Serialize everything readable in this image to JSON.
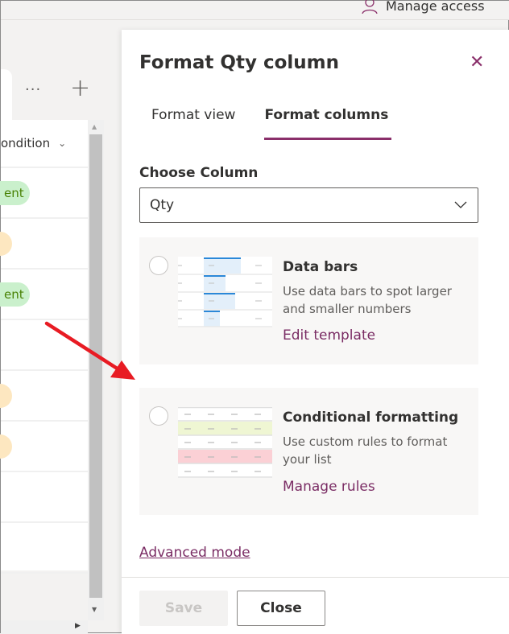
{
  "header": {
    "manage_access": "Manage access"
  },
  "list": {
    "more": "···",
    "add": "+",
    "column_header": "ondition",
    "rows": [
      {
        "pill": "ent",
        "color": "green"
      },
      {
        "pill": "",
        "color": "orange"
      },
      {
        "pill": "ent",
        "color": "green"
      },
      {
        "pill": "",
        "color": "none"
      },
      {
        "pill": "",
        "color": "orange"
      },
      {
        "pill": "",
        "color": "orange"
      },
      {
        "pill": "",
        "color": "none"
      },
      {
        "pill": "",
        "color": "none"
      }
    ]
  },
  "panel": {
    "title": "Format Qty column",
    "close": "✕",
    "tabs": [
      "Format view",
      "Format columns"
    ],
    "active_tab": "Format columns",
    "choose_label": "Choose Column",
    "selected_column": "Qty",
    "cards": [
      {
        "title": "Data bars",
        "desc": "Use data bars to spot larger and smaller numbers",
        "link": "Edit template"
      },
      {
        "title": "Conditional formatting",
        "desc": "Use custom rules to format your list",
        "link": "Manage rules"
      }
    ],
    "advanced": "Advanced mode",
    "save": "Save",
    "close_button": "Close"
  },
  "colors": {
    "accent": "#8a2f6a",
    "arrow": "#e81b23"
  }
}
